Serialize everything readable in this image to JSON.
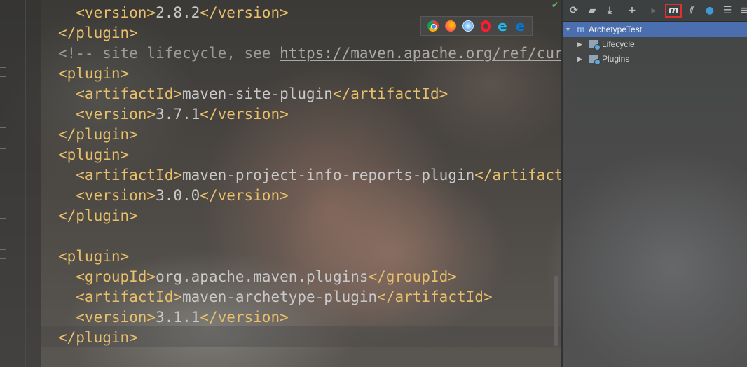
{
  "editor": {
    "lines": [
      [
        {
          "c": "tag",
          "t": "  <version>"
        },
        {
          "c": "txt",
          "t": "2.8.2"
        },
        {
          "c": "tag",
          "t": "</version>"
        }
      ],
      [
        {
          "c": "tag",
          "t": "</plugin>"
        }
      ],
      [
        {
          "c": "cmt",
          "t": "<!-- site lifecycle, see "
        },
        {
          "c": "url",
          "t": "https://maven.apache.org/ref/curr"
        }
      ],
      [
        {
          "c": "tag",
          "t": "<plugin>"
        }
      ],
      [
        {
          "c": "tag",
          "t": "  <artifactId>"
        },
        {
          "c": "txt",
          "t": "maven-site-plugin"
        },
        {
          "c": "tag",
          "t": "</artifactId>"
        }
      ],
      [
        {
          "c": "tag",
          "t": "  <version>"
        },
        {
          "c": "txt",
          "t": "3.7.1"
        },
        {
          "c": "tag",
          "t": "</version>"
        }
      ],
      [
        {
          "c": "tag",
          "t": "</plugin>"
        }
      ],
      [
        {
          "c": "tag",
          "t": "<plugin>"
        }
      ],
      [
        {
          "c": "tag",
          "t": "  <artifactId>"
        },
        {
          "c": "txt",
          "t": "maven-project-info-reports-plugin"
        },
        {
          "c": "tag",
          "t": "</artifactI"
        }
      ],
      [
        {
          "c": "tag",
          "t": "  <version>"
        },
        {
          "c": "txt",
          "t": "3.0.0"
        },
        {
          "c": "tag",
          "t": "</version>"
        }
      ],
      [
        {
          "c": "tag",
          "t": "</plugin>"
        }
      ],
      [
        {
          "c": "txt",
          "t": ""
        }
      ],
      [
        {
          "c": "tag",
          "t": "<plugin>"
        }
      ],
      [
        {
          "c": "tag",
          "t": "  <groupId>"
        },
        {
          "c": "txt",
          "t": "org.apache.maven.plugins"
        },
        {
          "c": "tag",
          "t": "</groupId>"
        }
      ],
      [
        {
          "c": "tag",
          "t": "  <artifactId>"
        },
        {
          "c": "txt",
          "t": "maven-archetype-plugin"
        },
        {
          "c": "tag",
          "t": "</artifactId>"
        }
      ],
      [
        {
          "c": "tag",
          "t": "  <version>"
        },
        {
          "c": "txt",
          "t": "3.1.1"
        },
        {
          "c": "tag",
          "t": "</version>"
        }
      ],
      [
        {
          "c": "tag",
          "t": "</plugin>"
        }
      ]
    ]
  },
  "browsers": [
    "chrome-icon",
    "firefox-icon",
    "safari-icon",
    "opera-icon",
    "ie-icon",
    "edge-icon"
  ],
  "maven": {
    "toolbar": {
      "m_label": "m"
    },
    "tree": {
      "root": "ArchetypeTest",
      "children": [
        "Lifecycle",
        "Plugins"
      ]
    }
  },
  "colors": {
    "tag": "#e8bf6a",
    "selection": "#4b6eaf",
    "highlight_border": "#e0302f"
  }
}
